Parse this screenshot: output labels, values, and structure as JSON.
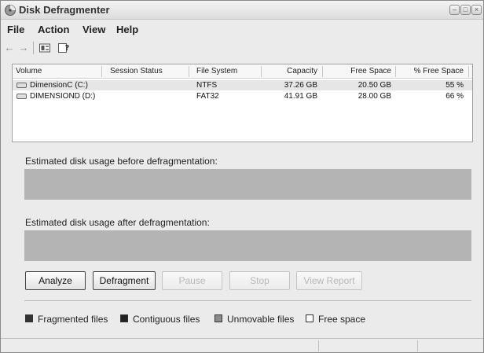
{
  "window": {
    "title": "Disk Defragmenter",
    "controls": {
      "minimize": "–",
      "maximize": "□",
      "close": "×"
    }
  },
  "menu": {
    "items": [
      "File",
      "Action",
      "View",
      "Help"
    ]
  },
  "toolbar": {
    "back_icon": "back-arrow-icon",
    "forward_icon": "forward-arrow-icon",
    "back": "←",
    "forward": "→"
  },
  "volumes": {
    "columns": [
      "Volume",
      "Session Status",
      "File System",
      "Capacity",
      "Free Space",
      "% Free Space"
    ],
    "rows": [
      {
        "volume": "DimensionC (C:)",
        "status": "",
        "file_system": "NTFS",
        "capacity": "37.26 GB",
        "free_space": "20.50 GB",
        "pct_free": "55 %"
      },
      {
        "volume": "DIMENSIOND (D:)",
        "status": "",
        "file_system": "FAT32",
        "capacity": "41.91 GB",
        "free_space": "28.00 GB",
        "pct_free": "66 %"
      }
    ]
  },
  "panel": {
    "before_label": "Estimated disk usage before defragmentation:",
    "after_label": "Estimated disk usage after defragmentation:",
    "buttons": {
      "analyze": "Analyze",
      "defragment": "Defragment",
      "pause": "Pause",
      "stop": "Stop",
      "view_report": "View Report"
    },
    "legend": [
      {
        "label": "Fragmented files",
        "color": "#333333"
      },
      {
        "label": "Contiguous files",
        "color": "#222222"
      },
      {
        "label": "Unmovable files",
        "color": "#8c8c8c"
      },
      {
        "label": "Free space",
        "color": "#ffffff"
      }
    ],
    "bar_color": "#b4b4b4"
  }
}
